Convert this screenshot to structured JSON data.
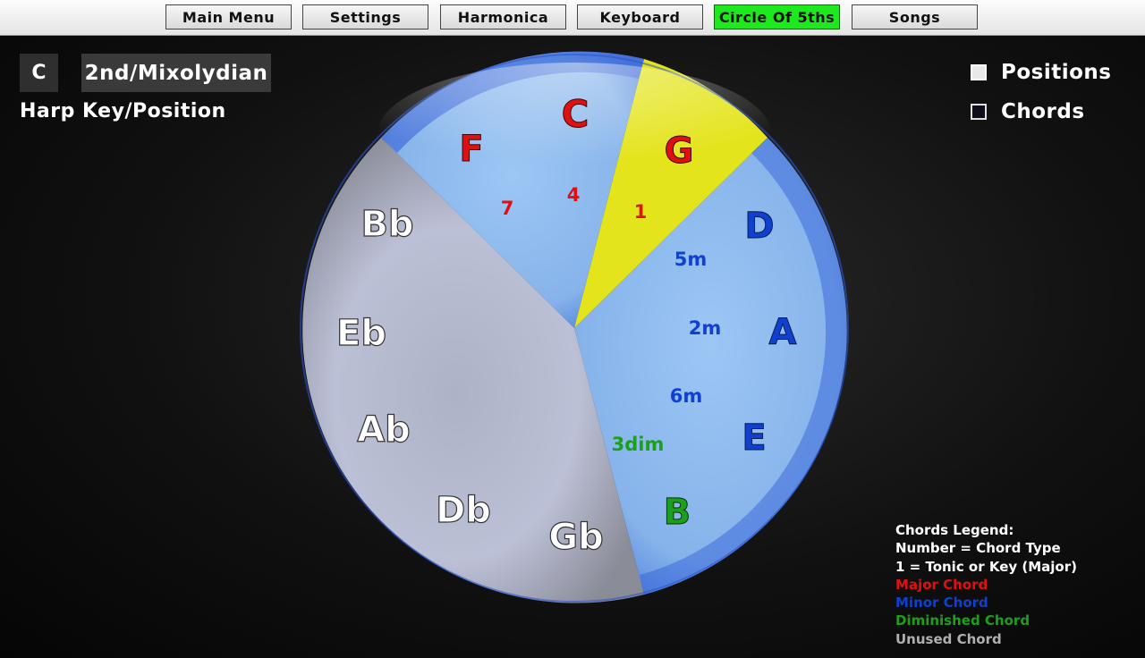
{
  "nav": {
    "main_menu": "Main Menu",
    "settings": "Settings",
    "harmonica": "Harmonica",
    "keyboard": "Keyboard",
    "circle_of_fifths": "Circle Of 5ths",
    "songs": "Songs",
    "active_color": "#1ee81e"
  },
  "harp": {
    "key": "C",
    "position": "2nd/Mixolydian",
    "caption": "Harp Key/Position"
  },
  "options": {
    "positions": {
      "label": "Positions",
      "checked": true
    },
    "chords": {
      "label": "Chords",
      "checked": false
    }
  },
  "circle": {
    "colors": {
      "major": "#e01010",
      "minor": "#1040d0",
      "diminished": "#1ca01c",
      "unused": "#ffffff",
      "active_sector": "#e4e41c",
      "used_sector": "#8ab6ec",
      "unused_sector": "#b8bcd0"
    },
    "notes": {
      "C": "C",
      "G": "G",
      "D": "D",
      "A": "A",
      "E": "E",
      "B": "B",
      "Gb": "Gb",
      "Db": "Db",
      "Ab": "Ab",
      "Eb": "Eb",
      "Bb": "Bb",
      "F": "F"
    },
    "degrees": {
      "seven": "7",
      "four": "4",
      "one": "1",
      "five_m": "5m",
      "two_m": "2m",
      "six_m": "6m",
      "three_dim": "3dim"
    }
  },
  "legend": {
    "title": "Chords Legend:",
    "line1": "Number = Chord Type",
    "line2": "1 = Tonic or Key (Major)",
    "major": "Major Chord",
    "minor": "Minor Chord",
    "diminished": "Diminished Chord",
    "unused": "Unused Chord",
    "colors": {
      "text": "#ffffff",
      "major": "#e01010",
      "minor": "#1040d0",
      "diminished": "#1ca01c",
      "unused": "#b0b0b0"
    }
  }
}
